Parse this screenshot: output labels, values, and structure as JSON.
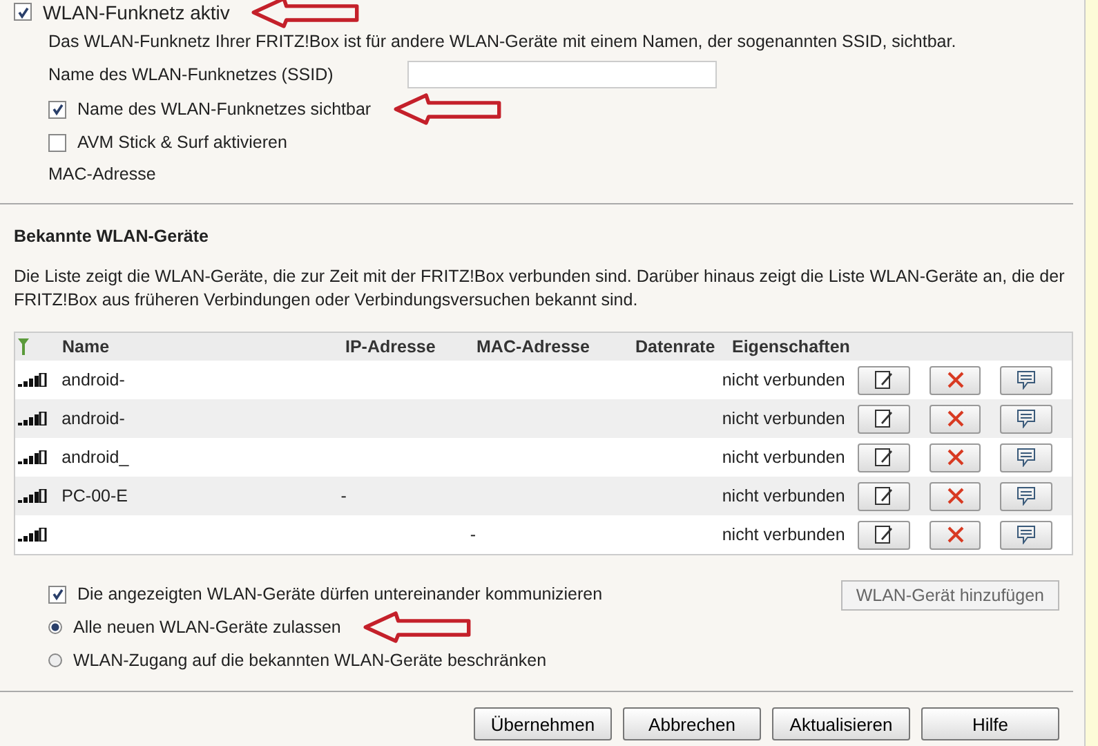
{
  "wlan_active": {
    "label": "WLAN-Funknetz aktiv",
    "checked": true,
    "highlighted": true
  },
  "description": "Das WLAN-Funknetz Ihrer FRITZ!Box ist für andere WLAN-Geräte mit einem Namen, der sogenannten SSID, sichtbar.",
  "ssid": {
    "label": "Name des WLAN-Funknetzes (SSID)"
  },
  "options": [
    {
      "label": "Name des WLAN-Funknetzes sichtbar",
      "checked": true,
      "highlighted": true
    },
    {
      "label": "AVM Stick & Surf aktivieren",
      "checked": false,
      "highlighted": false
    }
  ],
  "mac": {
    "label": "MAC-Adresse"
  },
  "known_devices": {
    "heading": "Bekannte WLAN-Geräte",
    "description": "Die Liste zeigt die WLAN-Geräte, die zur Zeit mit der FRITZ!Box verbunden sind. Darüber hinaus zeigt die Liste WLAN-Geräte an, die der FRITZ!Box aus früheren Verbindungen oder Verbindungsversuchen bekannt sind.",
    "columns": [
      "Name",
      "IP-Adresse",
      "MAC-Adresse",
      "Datenrate",
      "Eigenschaften"
    ],
    "rows": [
      {
        "name": "android-",
        "ip": "",
        "mac": "",
        "status": "nicht verbunden"
      },
      {
        "name": "android-",
        "ip": "",
        "mac": "",
        "status": "nicht verbunden"
      },
      {
        "name": "android_",
        "ip": "",
        "mac": "",
        "status": "nicht verbunden"
      },
      {
        "name": "PC-00-E",
        "ip": "-",
        "mac": "",
        "status": "nicht verbunden"
      },
      {
        "name": "",
        "ip": "",
        "mac": "-",
        "status": "nicht verbunden"
      }
    ]
  },
  "communicate": {
    "label": "Die angezeigten WLAN-Geräte dürfen untereinander kommunizieren",
    "checked": true
  },
  "add_button": "WLAN-Gerät hinzufügen",
  "access": [
    {
      "label": "Alle neuen WLAN-Geräte zulassen",
      "selected": true,
      "highlighted": true
    },
    {
      "label": "WLAN-Zugang auf die bekannten WLAN-Geräte beschränken",
      "selected": false,
      "highlighted": false
    }
  ],
  "buttons": [
    "Übernehmen",
    "Abbrechen",
    "Aktualisieren",
    "Hilfe"
  ]
}
